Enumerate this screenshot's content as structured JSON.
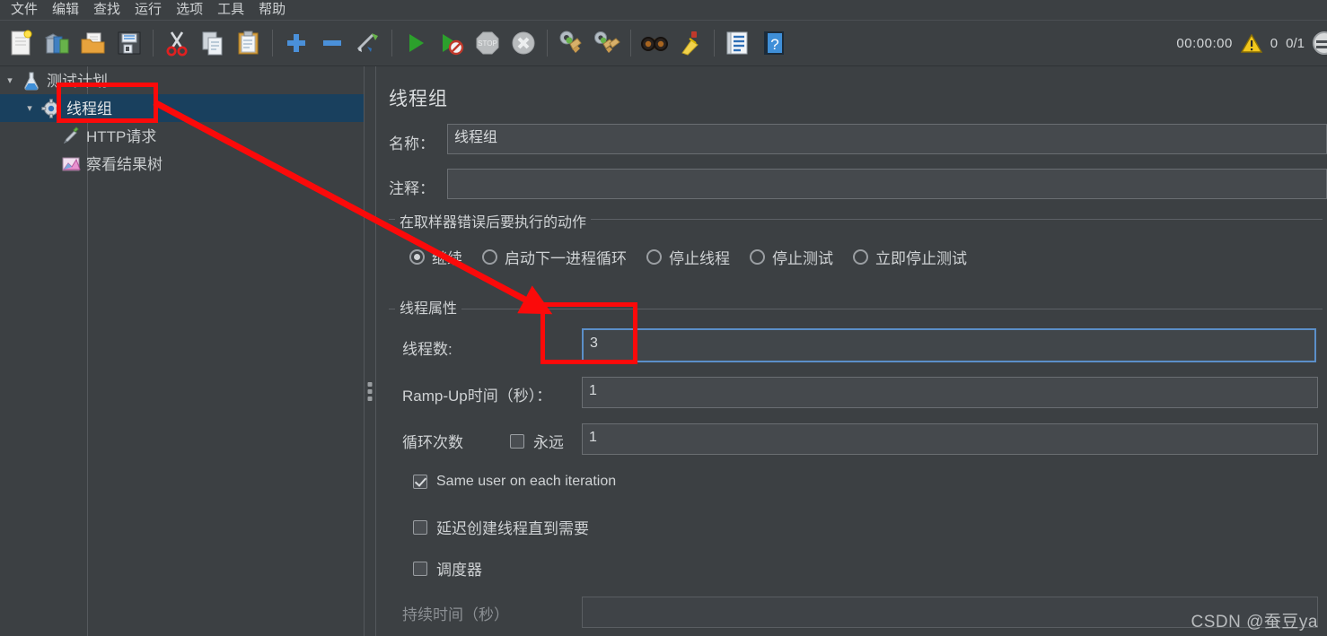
{
  "menu": {
    "items": [
      {
        "label": "文件"
      },
      {
        "label": "编辑"
      },
      {
        "label": "查找"
      },
      {
        "label": "运行"
      },
      {
        "label": "选项"
      },
      {
        "label": "工具"
      },
      {
        "label": "帮助"
      }
    ]
  },
  "toolbar": {
    "icons": [
      {
        "name": "new-icon",
        "title": "新建"
      },
      {
        "name": "templates-icon",
        "title": "模板"
      },
      {
        "name": "open-icon",
        "title": "打开"
      },
      {
        "name": "save-icon",
        "title": "保存"
      },
      {
        "name": "cut-icon",
        "title": "剪切"
      },
      {
        "name": "copy-icon",
        "title": "复制"
      },
      {
        "name": "paste-icon",
        "title": "粘贴"
      },
      {
        "name": "expand-all-icon",
        "title": "展开全部"
      },
      {
        "name": "collapse-all-icon",
        "title": "收起全部"
      },
      {
        "name": "toggle-icon",
        "title": "启用/禁用"
      },
      {
        "name": "start-icon",
        "title": "启动"
      },
      {
        "name": "start-no-pauses-icon",
        "title": "无间隔启动"
      },
      {
        "name": "stop-icon",
        "title": "停止"
      },
      {
        "name": "shutdown-icon",
        "title": "关闭"
      },
      {
        "name": "clear-icon",
        "title": "清除"
      },
      {
        "name": "clear-all-icon",
        "title": "清除全部"
      },
      {
        "name": "search-icon",
        "title": "搜索"
      },
      {
        "name": "reset-search-icon",
        "title": "重置搜索"
      },
      {
        "name": "function-helper-icon",
        "title": "函数助手"
      },
      {
        "name": "help-icon",
        "title": "帮助"
      }
    ],
    "status": {
      "elapsed": "00:00:00",
      "error_count": "0",
      "thread_count": "0/1"
    }
  },
  "tree": {
    "nodes": [
      {
        "label": "测试计划",
        "icon": "test-plan-icon",
        "expanded": true,
        "selected": false
      },
      {
        "label": "线程组",
        "icon": "thread-group-icon",
        "expanded": true,
        "selected": true
      },
      {
        "label": "HTTP请求",
        "icon": "http-request-icon",
        "expanded": false,
        "selected": false
      },
      {
        "label": "察看结果树",
        "icon": "view-results-tree-icon",
        "expanded": false,
        "selected": false
      }
    ]
  },
  "panel": {
    "title": "线程组",
    "name_label": "名称：",
    "name_value": "线程组",
    "comment_label": "注释：",
    "comment_value": "",
    "error_action": {
      "group_title": "在取样器错误后要执行的动作",
      "options": [
        {
          "label": "继续",
          "selected": true
        },
        {
          "label": "启动下一进程循环",
          "selected": false
        },
        {
          "label": "停止线程",
          "selected": false
        },
        {
          "label": "停止测试",
          "selected": false
        },
        {
          "label": "立即停止测试",
          "selected": false
        }
      ]
    },
    "thread_properties": {
      "group_title": "线程属性",
      "threads_label": "线程数:",
      "threads_value": "3",
      "rampup_label": "Ramp-Up时间（秒）：",
      "rampup_value": "1",
      "loops_label": "循环次数",
      "forever_label": "永远",
      "forever_checked": false,
      "loops_value": "1",
      "same_user_label": "Same user on each iteration",
      "same_user_checked": true,
      "delay_label": "延迟创建线程直到需要",
      "delay_checked": false,
      "scheduler_label": "调度器",
      "scheduler_checked": false,
      "duration_label": "持续时间（秒）",
      "duration_value": "",
      "duration_disabled": true
    }
  },
  "annotations": {
    "accent_color": "#fb0a0a",
    "highlight_tree_node": "线程组",
    "highlight_field": "线程数",
    "arrow_from": "线程组",
    "arrow_to": "线程数"
  },
  "watermark": {
    "text": "CSDN @蚕豆ya"
  }
}
